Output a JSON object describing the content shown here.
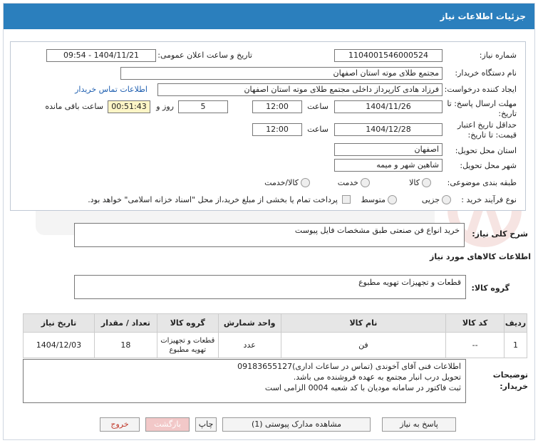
{
  "header": {
    "title": "جزئیات اطلاعات نیاز"
  },
  "form": {
    "need_number_label": "شماره نیاز:",
    "need_number": "1104001546000524",
    "announce_label": "تاریخ و ساعت اعلان عمومی:",
    "announce_value": "1404/11/21 - 09:54",
    "buyer_org_label": "نام دستگاه خریدار:",
    "buyer_org": "مجتمع طلای موته استان اصفهان",
    "creator_label": "ایجاد کننده درخواست:",
    "creator": "فرزاد هادی کارپرداز داخلی مجتمع طلای موته استان اصفهان",
    "contact_link": "اطلاعات تماس خریدار",
    "deadline_label_1": "مهلت ارسال پاسخ: تا",
    "deadline_label_2": "تاریخ:",
    "deadline_date": "1404/11/26",
    "time_label": "ساعت",
    "deadline_time": "12:00",
    "days": "5",
    "days_label": "روز و",
    "remaining_time": "00:51:43",
    "remaining_label": "ساعت باقی مانده",
    "min_valid_label_1": "حداقل تاریخ اعتبار",
    "min_valid_label_2": "قیمت: تا تاریخ:",
    "min_valid_date": "1404/12/28",
    "min_valid_time": "12:00",
    "province_label": "استان محل تحویل:",
    "province": "اصفهان",
    "city_label": "شهر محل تحویل:",
    "city": "شاهین شهر و میمه",
    "category_label": "طبقه بندی موضوعی:",
    "category_options": [
      "کالا",
      "خدمت",
      "کالا/خدمت"
    ],
    "process_label": "نوع فرآیند خرید :",
    "process_options": [
      "جزیی",
      "متوسط"
    ],
    "payment_note": "پرداخت تمام یا بخشی از مبلغ خرید،از محل \"اسناد خزانه اسلامی\" خواهد بود."
  },
  "description": {
    "label": "شرح کلی نیاز:",
    "value": "خرید انواع فن صنعتی طبق مشخصات فایل پیوست"
  },
  "goods_info_title": "اطلاعات کالاهای مورد نیاز",
  "goods_group": {
    "label": "گروه کالا:",
    "value": "قطعات و تجهیزات تهویه مطبوع"
  },
  "table": {
    "headers": [
      "ردیف",
      "کد کالا",
      "نام کالا",
      "واحد شمارش",
      "گروه کالا",
      "تعداد / مقدار",
      "تاریخ نیاز"
    ],
    "rows": [
      [
        "1",
        "--",
        "فن",
        "عدد",
        "قطعات و تجهیزات تهویه مطبوع",
        "18",
        "1404/12/03"
      ]
    ]
  },
  "buyer_notes": {
    "label_1": "توضیحات",
    "label_2": "خریدار:",
    "lines": [
      "اطلاعات فنی آقای آخوندی (تماس در ساعات اداری)09183655127",
      "تحویل درب انبار مجتمع به عهده فروشنده می باشد.",
      "ثبت فاکتور در سامانه مودیان با کد شعبه 0004 الزامی است"
    ]
  },
  "buttons": {
    "reply": "پاسخ به نیاز",
    "attachments": "مشاهده مدارک پیوستی (1)",
    "print": "چاپ",
    "back": "بازگشت",
    "exit": "خروج"
  },
  "colors": {
    "header_bg": "#2b7fbd",
    "remaining_bg": "#fdf5c6",
    "exit_text": "#c0392b",
    "back_bg": "#f2c8c8"
  }
}
